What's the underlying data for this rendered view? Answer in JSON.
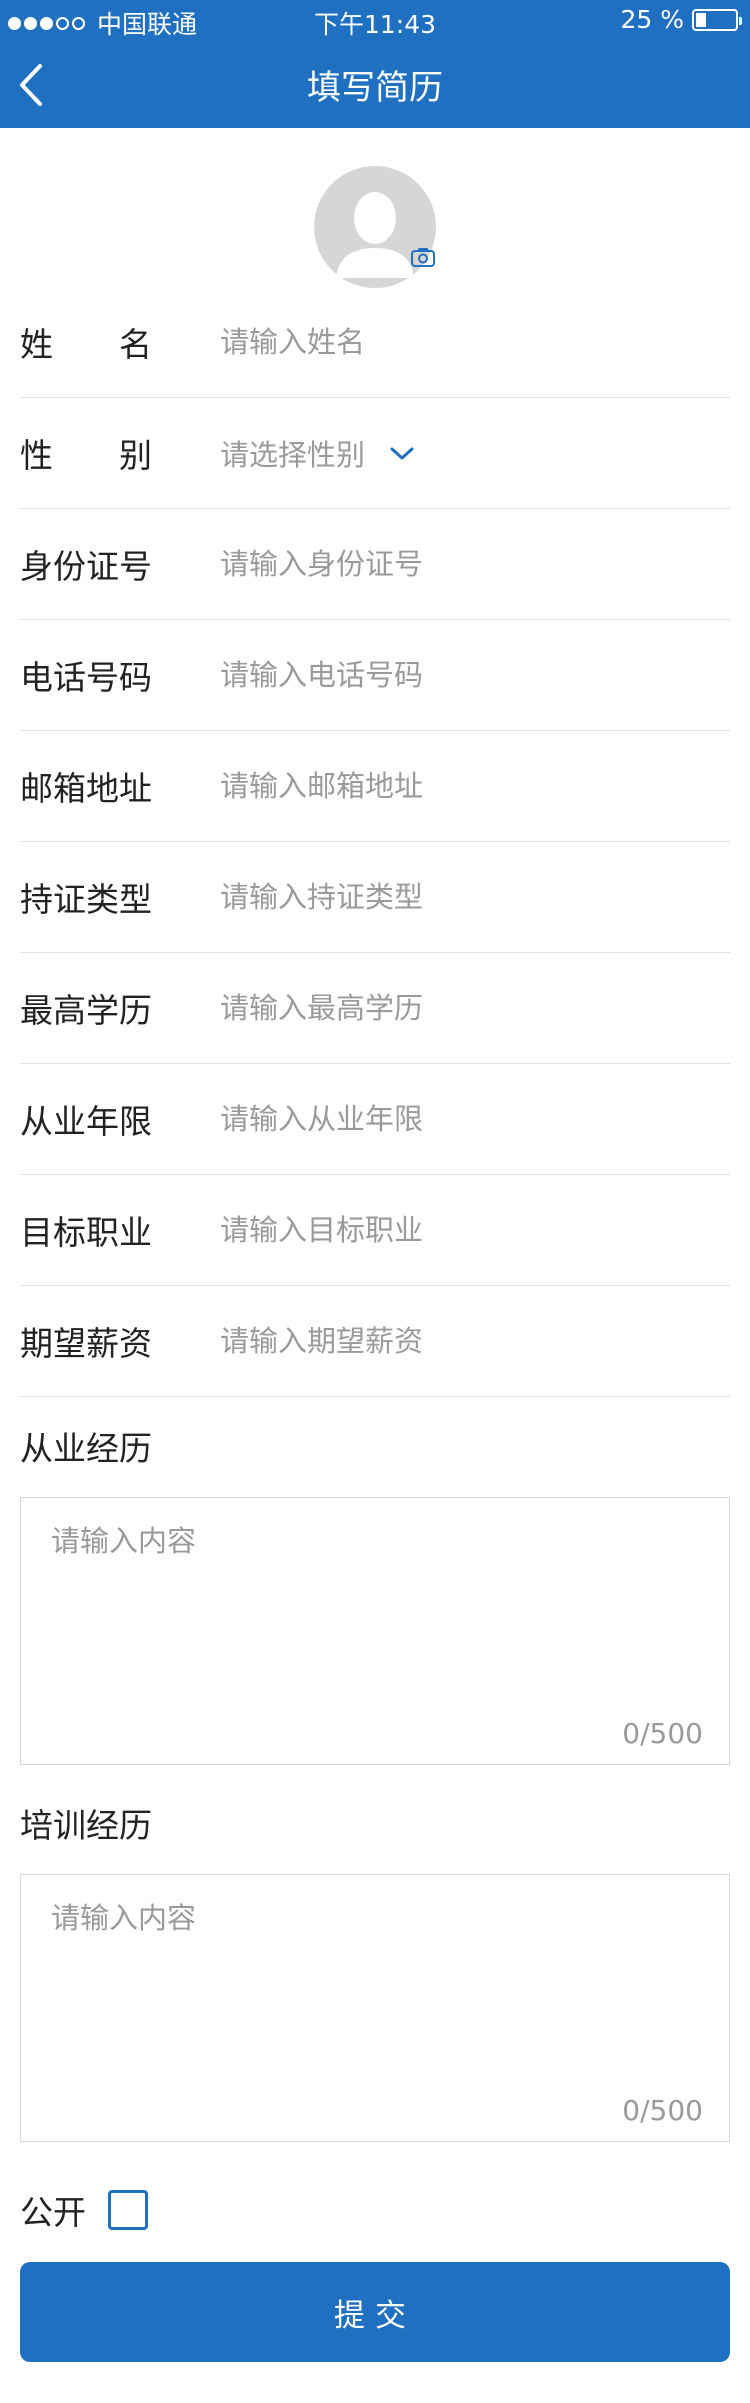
{
  "status_bar": {
    "carrier": "中国联通",
    "time": "下午11:43",
    "battery_text": "25 %",
    "battery_level": 0.25
  },
  "header": {
    "title": "填写简历",
    "back_icon": "chevron-left-icon"
  },
  "avatar": {
    "icon": "user-silhouette-icon",
    "camera_icon": "camera-icon"
  },
  "fields": {
    "name": {
      "label_a": "姓",
      "label_b": "名",
      "placeholder": "请输入姓名"
    },
    "gender": {
      "label_a": "性",
      "label_b": "别",
      "placeholder": "请选择性别"
    },
    "id_number": {
      "label": "身份证号",
      "placeholder": "请输入身份证号"
    },
    "phone": {
      "label": "电话号码",
      "placeholder": "请输入电话号码"
    },
    "email": {
      "label": "邮箱地址",
      "placeholder": "请输入邮箱地址"
    },
    "certificate": {
      "label": "持证类型",
      "placeholder": "请输入持证类型"
    },
    "education": {
      "label": "最高学历",
      "placeholder": "请输入最高学历"
    },
    "years": {
      "label": "从业年限",
      "placeholder": "请输入从业年限"
    },
    "target_job": {
      "label": "目标职业",
      "placeholder": "请输入目标职业"
    },
    "salary": {
      "label": "期望薪资",
      "placeholder": "请输入期望薪资"
    }
  },
  "work_experience": {
    "label": "从业经历",
    "placeholder": "请输入内容",
    "counter": "0/500"
  },
  "training_experience": {
    "label": "培训经历",
    "placeholder": "请输入内容",
    "counter": "0/500"
  },
  "public": {
    "label": "公开",
    "checked": false
  },
  "submit": {
    "label": "提交"
  },
  "colors": {
    "brand": "#2070c2",
    "placeholder": "#9a9a9a",
    "divider": "#e3e3e3"
  }
}
